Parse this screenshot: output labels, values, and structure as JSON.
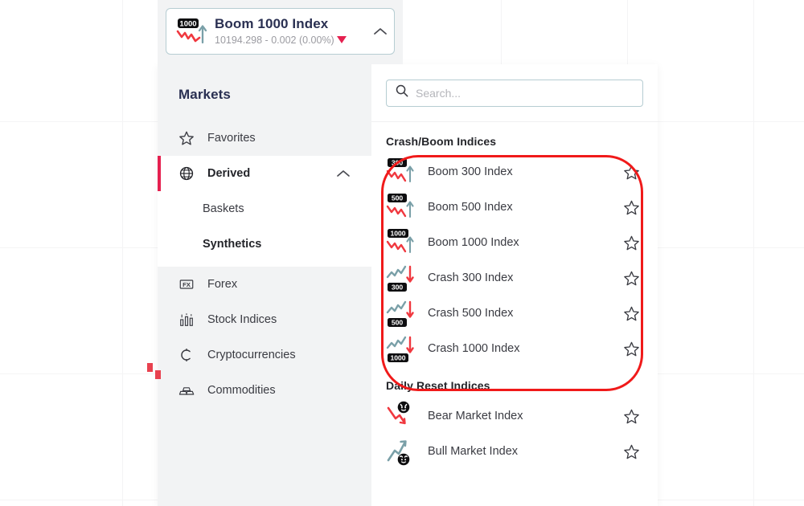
{
  "header_card": {
    "icon": "boom-1000-icon",
    "badge": "1000",
    "title": "Boom 1000 Index",
    "subtitle": "10194.298 - 0.002 (0.00%)",
    "direction_icon": "triangle-down-icon",
    "collapse_icon": "chevron-up-icon",
    "accent_color": "#e5204f"
  },
  "sidebar": {
    "title": "Markets",
    "items": [
      {
        "label": "Favorites",
        "icon": "star-icon",
        "active": false
      },
      {
        "label": "Derived",
        "icon": "globe-icon",
        "active": true,
        "chevron": "chevron-up-icon"
      },
      {
        "label": "Forex",
        "icon": "fx-icon",
        "active": false
      },
      {
        "label": "Stock Indices",
        "icon": "bar-chart-icon",
        "active": false
      },
      {
        "label": "Cryptocurrencies",
        "icon": "crypto-coin-icon",
        "active": false
      },
      {
        "label": "Commodities",
        "icon": "gold-bars-icon",
        "active": false
      }
    ],
    "sub_items": [
      {
        "label": "Baskets",
        "selected": false
      },
      {
        "label": "Synthetics",
        "selected": true
      }
    ]
  },
  "search": {
    "icon": "search-icon",
    "value": "",
    "placeholder": "Search..."
  },
  "sections": [
    {
      "title": "Crash/Boom Indices",
      "items": [
        {
          "label": "Boom 300 Index",
          "icon": "boom-icon",
          "badge": "300",
          "star": "star-icon"
        },
        {
          "label": "Boom 500 Index",
          "icon": "boom-icon",
          "badge": "500",
          "star": "star-icon"
        },
        {
          "label": "Boom 1000 Index",
          "icon": "boom-icon",
          "badge": "1000",
          "star": "star-icon"
        },
        {
          "label": "Crash 300 Index",
          "icon": "crash-icon",
          "badge": "300",
          "star": "star-icon"
        },
        {
          "label": "Crash 500 Index",
          "icon": "crash-icon",
          "badge": "500",
          "star": "star-icon"
        },
        {
          "label": "Crash 1000 Index",
          "icon": "crash-icon",
          "badge": "1000",
          "star": "star-icon"
        }
      ]
    },
    {
      "title": "Daily Reset Indices",
      "items": [
        {
          "label": "Bear Market Index",
          "icon": "bear-icon",
          "badge": "",
          "star": "star-icon"
        },
        {
          "label": "Bull Market Index",
          "icon": "bull-icon",
          "badge": "",
          "star": "star-icon"
        }
      ]
    }
  ],
  "annotation": {
    "shape": "red-ellipse-highlight",
    "color": "#f01a1a"
  }
}
